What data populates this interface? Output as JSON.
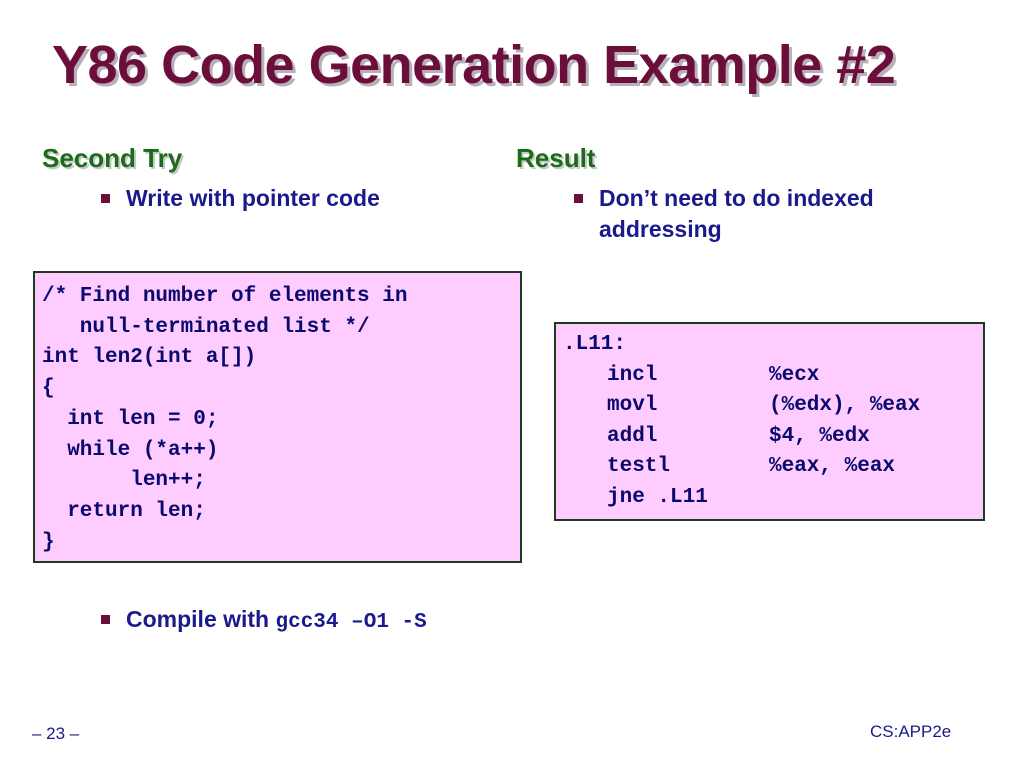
{
  "title": "Y86 Code Generation Example #2",
  "left": {
    "heading": "Second Try",
    "bullet1": "Write with pointer code",
    "code": [
      "/* Find number of elements in",
      "   null-terminated list */",
      "int len2(int a[])",
      "{",
      "  int len = 0;",
      "  while (*a++)",
      "       len++;",
      "  return len;",
      "}"
    ],
    "bullet2_text": "Compile with ",
    "bullet2_code": "gcc34 –O1 -S"
  },
  "right": {
    "heading": "Result",
    "bullet1_line1": "Don’t need to do indexed",
    "bullet1_line2": "addressing",
    "label": ".L11:",
    "instructions": [
      {
        "op": "incl",
        "args": "%ecx"
      },
      {
        "op": "movl",
        "args": "(%edx), %eax"
      },
      {
        "op": "addl",
        "args": "$4, %edx"
      },
      {
        "op": "testl",
        "args": "%eax, %eax"
      },
      {
        "op": "jne .L11",
        "args": ""
      }
    ]
  },
  "footer": {
    "page": "– 23 –",
    "course": "CS:APP2e"
  }
}
